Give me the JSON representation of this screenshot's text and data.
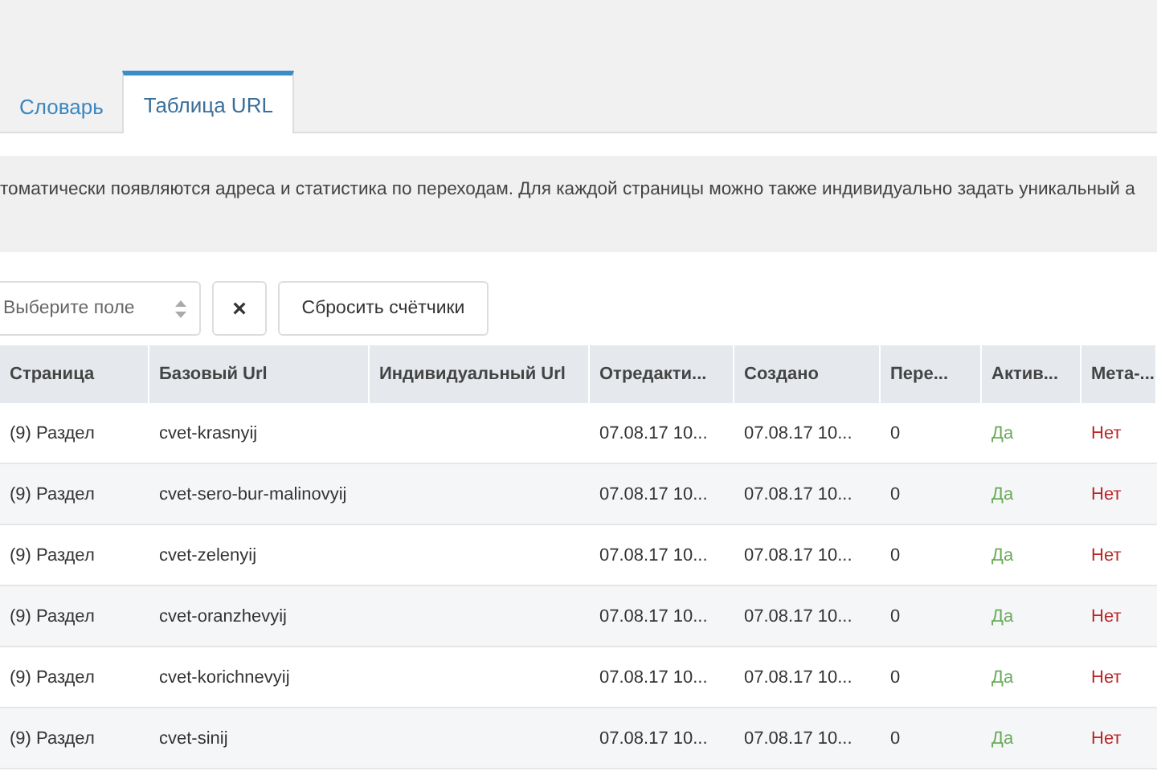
{
  "tabs": [
    {
      "label": "Словарь",
      "selected": false
    },
    {
      "label": "Таблица URL",
      "selected": true
    }
  ],
  "info": "томатически появляются адреса и статистика по переходам. Для каждой страницы можно также индивидуально задать уникальный а",
  "toolbar": {
    "select_placeholder": "Выберите поле",
    "clear_button": "×",
    "reset_button": "Сбросить счётчики"
  },
  "table": {
    "columns": [
      "Страница",
      "Базовый Url",
      "Индивидуальный Url",
      "Отредакти...",
      "Создано",
      "Пере...",
      "Актив...",
      "Мета-..."
    ],
    "rows": [
      {
        "page": "(9) Раздел",
        "base_url": "cvet-krasnyij",
        "edited": "07.08.17 10...",
        "created": "07.08.17 10...",
        "hits": "0",
        "active": {
          "text": "Да",
          "value": true
        },
        "meta": {
          "text": "Нет",
          "value": false
        }
      },
      {
        "page": "(9) Раздел",
        "base_url": "cvet-sero-bur-malinovyij",
        "edited": "07.08.17 10...",
        "created": "07.08.17 10...",
        "hits": "0",
        "active": {
          "text": "Да",
          "value": true
        },
        "meta": {
          "text": "Нет",
          "value": false
        }
      },
      {
        "page": "(9) Раздел",
        "base_url": "cvet-zelenyij",
        "edited": "07.08.17 10...",
        "created": "07.08.17 10...",
        "hits": "0",
        "active": {
          "text": "Да",
          "value": true
        },
        "meta": {
          "text": "Нет",
          "value": false
        }
      },
      {
        "page": "(9) Раздел",
        "base_url": "cvet-oranzhevyij",
        "edited": "07.08.17 10...",
        "created": "07.08.17 10...",
        "hits": "0",
        "active": {
          "text": "Да",
          "value": true
        },
        "meta": {
          "text": "Нет",
          "value": false
        }
      },
      {
        "page": "(9) Раздел",
        "base_url": "cvet-korichnevyij",
        "edited": "07.08.17 10...",
        "created": "07.08.17 10...",
        "hits": "0",
        "active": {
          "text": "Да",
          "value": true
        },
        "meta": {
          "text": "Нет",
          "value": false
        }
      },
      {
        "page": "(9) Раздел",
        "base_url": "cvet-sinij",
        "edited": "07.08.17 10...",
        "created": "07.08.17 10...",
        "hits": "0",
        "active": {
          "text": "Да",
          "value": true
        },
        "meta": {
          "text": "Нет",
          "value": false
        }
      }
    ]
  }
}
